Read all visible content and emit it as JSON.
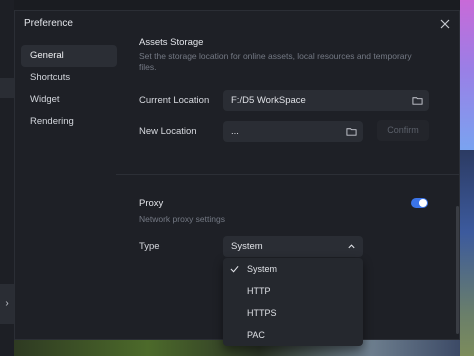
{
  "dialog": {
    "title": "Preference"
  },
  "sidebar": {
    "items": [
      {
        "label": "General",
        "active": true
      },
      {
        "label": "Shortcuts"
      },
      {
        "label": "Widget"
      },
      {
        "label": "Rendering"
      }
    ]
  },
  "assets_storage": {
    "title": "Assets Storage",
    "description": "Set the storage location for online assets, local resources and temporary files.",
    "current_location_label": "Current Location",
    "current_location_value": "F:/D5 WorkSpace",
    "new_location_label": "New Location",
    "new_location_value": "...",
    "confirm_label": "Confirm"
  },
  "proxy": {
    "title": "Proxy",
    "description": "Network proxy settings",
    "enabled": true,
    "type_label": "Type",
    "selected": "System",
    "options": [
      "System",
      "HTTP",
      "HTTPS",
      "PAC"
    ]
  },
  "background": {
    "left_arrow": "›"
  },
  "colors": {
    "accent": "#3b74e8",
    "dialog_bg": "#1e2026",
    "field_bg": "#2a2d34"
  },
  "icons": [
    "close-icon",
    "folder-icon",
    "chevron-up-icon",
    "check-icon",
    "chevron-right-icon"
  ]
}
